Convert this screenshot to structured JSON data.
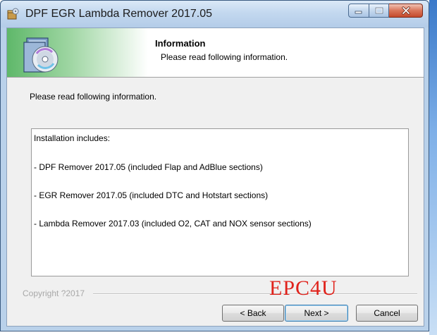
{
  "window": {
    "title": "DPF EGR Lambda Remover 2017.05",
    "icons": {
      "app": "setup-box-icon",
      "minimize": "minimize-icon",
      "maximize": "maximize-icon",
      "close": "close-icon"
    }
  },
  "header": {
    "title": "Information",
    "subtitle": "Please read following information.",
    "graphic": "setup-disc-icon"
  },
  "body": {
    "label": "Please read following information.",
    "info_lines": [
      "Installation includes:",
      " - DPF Remover 2017.05 (included Flap and AdBlue sections)",
      " - EGR Remover 2017.05 (included DTC and Hotstart sections)",
      " - Lambda Remover 2017.03 (included O2, CAT and NOX sensor sections)"
    ]
  },
  "footer": {
    "copyright": "Copyright ?2017",
    "watermark": "EPC4U",
    "back_label": "< Back",
    "next_label": "Next >",
    "cancel_label": "Cancel"
  },
  "colors": {
    "header_gradient": "#5fb86a",
    "watermark": "#e0221b",
    "close_button": "#c44a2c"
  }
}
